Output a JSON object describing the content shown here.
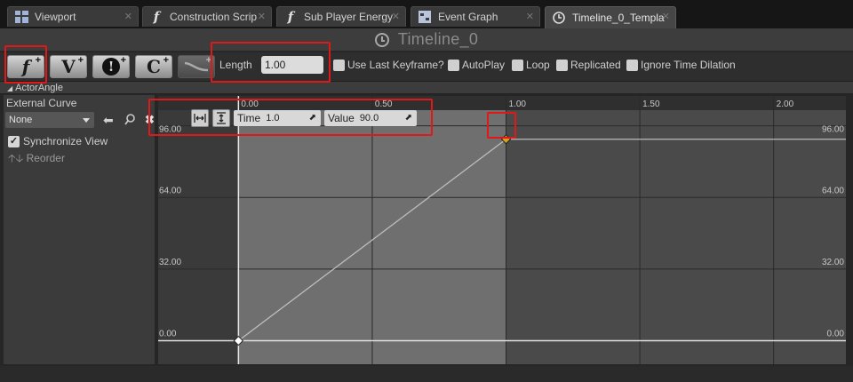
{
  "tabs": [
    {
      "label": "Viewport",
      "icon": "viewport-icon"
    },
    {
      "label": "Construction Scrip",
      "icon": "function-icon"
    },
    {
      "label": "Sub Player Energy",
      "icon": "function-icon"
    },
    {
      "label": "Event Graph",
      "icon": "graph-icon"
    },
    {
      "label": "Timeline_0_Templa",
      "icon": "clock-icon"
    }
  ],
  "timeline_title": "Timeline_0",
  "toolbar": {
    "add_float_track": "f",
    "add_vector_track": "V",
    "add_event_track": "!",
    "add_color_track": "C",
    "plus": "+",
    "length_label": "Length",
    "length_value": "1.00",
    "options": [
      {
        "label": "Use Last Keyframe?",
        "checked": false
      },
      {
        "label": "AutoPlay",
        "checked": false
      },
      {
        "label": "Loop",
        "checked": false
      },
      {
        "label": "Replicated",
        "checked": false
      },
      {
        "label": "Ignore Time Dilation",
        "checked": false
      }
    ]
  },
  "track": {
    "name": "ActorAngle",
    "external_curve_label": "External Curve",
    "external_curve_value": "None",
    "sync_label": "Synchronize View",
    "sync_checked": true,
    "reorder_label": "Reorder"
  },
  "keyframe_editor": {
    "time_label": "Time",
    "time_value": "1.0",
    "value_label": "Value",
    "value_value": "90.0"
  },
  "graph": {
    "x_ticks": [
      "0.00",
      "0.50",
      "1.00",
      "1.50",
      "2.00"
    ],
    "y_ticks_left": [
      "96.00",
      "64.00",
      "32.00",
      "0.00"
    ],
    "y_ticks_right": [
      "96.00",
      "64.00",
      "32.00",
      "0.00"
    ]
  },
  "chart_data": {
    "type": "line",
    "x": [
      0.0,
      1.0
    ],
    "y": [
      0.0,
      90.0
    ],
    "xlim": [
      -0.3,
      2.27
    ],
    "ylim": [
      -10.5,
      103
    ],
    "active_range": [
      0.0,
      1.0
    ],
    "colors": {
      "curve": "#bdbdbd",
      "selected_key": "#d8a020",
      "key": "#ffffff"
    }
  }
}
